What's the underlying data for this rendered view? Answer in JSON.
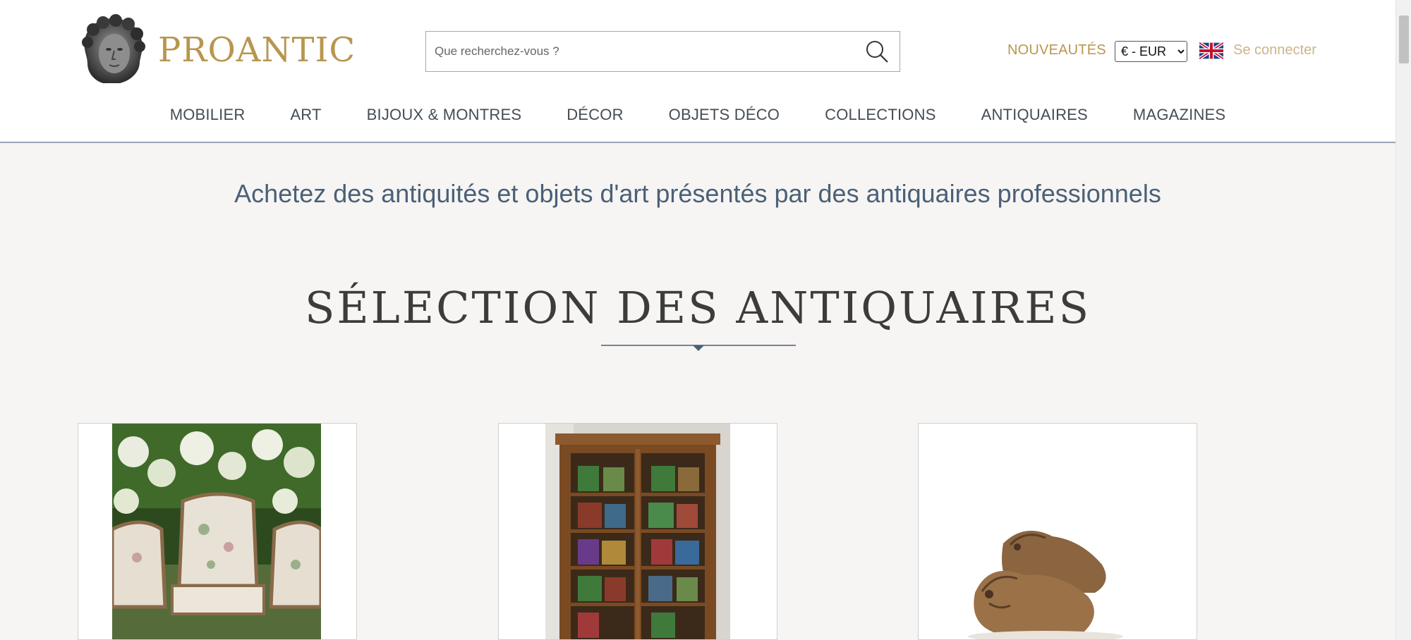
{
  "header": {
    "logo_text": "PROANTIC",
    "search_placeholder": "Que recherchez-vous ?",
    "nouveautes": "NOUVEAUTÉS",
    "currency_selected": "€ - EUR",
    "login": "Se connecter",
    "icons": {
      "search": "search-icon",
      "flag": "uk-flag-icon",
      "logo": "logo-head-icon"
    }
  },
  "nav": {
    "items": [
      "MOBILIER",
      "ART",
      "BIJOUX & MONTRES",
      "DÉCOR",
      "OBJETS DÉCO",
      "COLLECTIONS",
      "ANTIQUAIRES",
      "MAGAZINES"
    ]
  },
  "main": {
    "tagline": "Achetez des antiquités et objets d'art présentés par des antiquaires professionnels",
    "section_title": "SÉLECTION DES ANTIQUAIRES"
  },
  "colors": {
    "brand_gold": "#b8964f",
    "accent_blue": "#4b6078",
    "background": "#f6f5f3"
  }
}
